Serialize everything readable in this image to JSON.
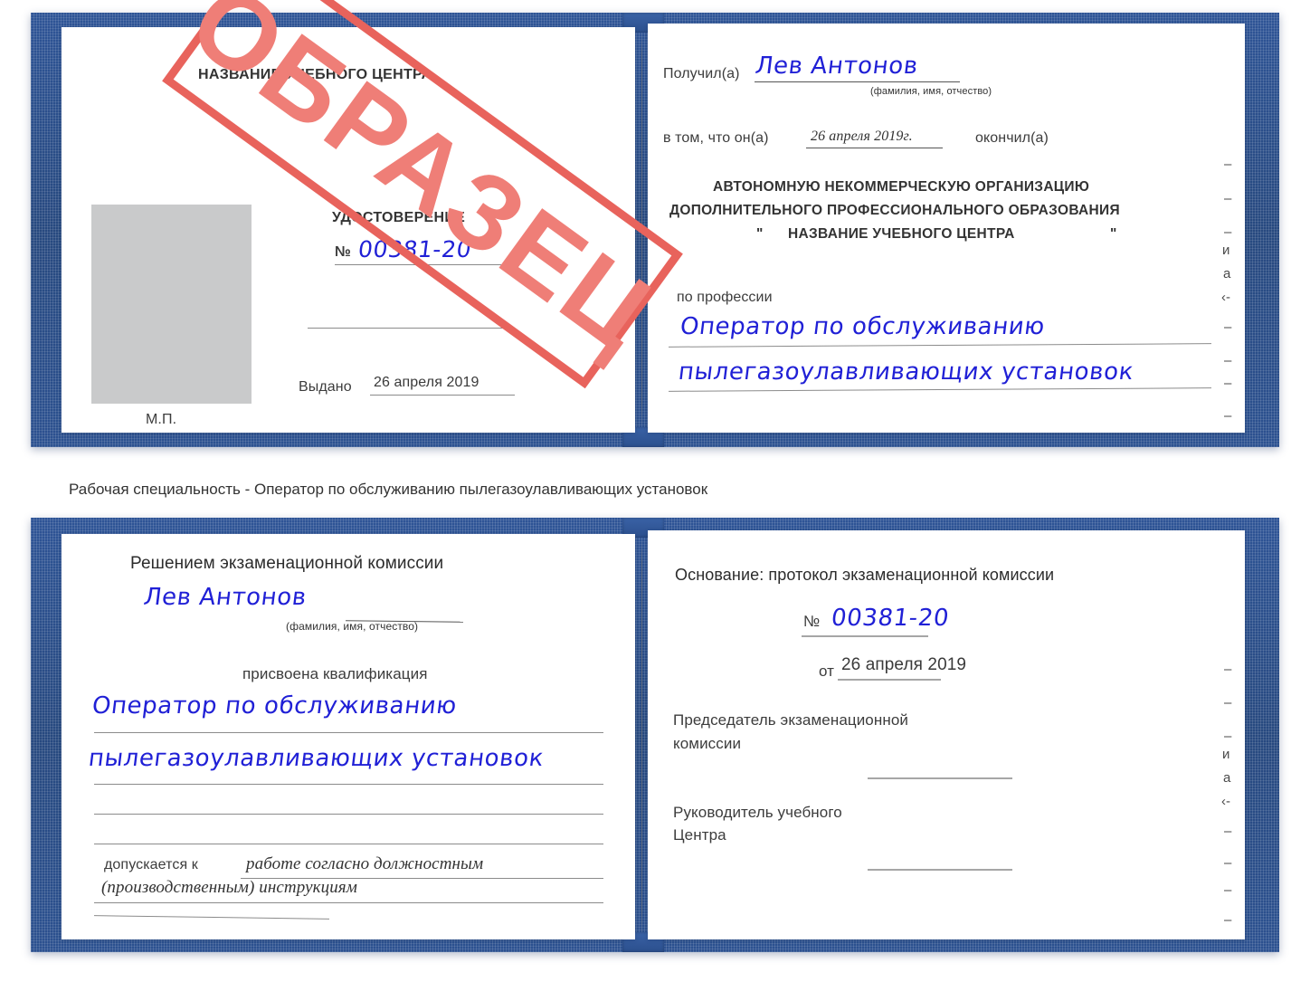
{
  "caption": "Рабочая специальность - Оператор по обслуживанию пылегазоулавливающих установок",
  "watermark": {
    "text": "ОБРАЗЕЦ",
    "border_color": "#e8635c",
    "text_color": "#ef7e77"
  },
  "colors": {
    "cover_blue": "#2c5190",
    "page_white": "#ffffff",
    "ink_blue": "#2020d6",
    "print_gray": "#3c3c3c",
    "photo_gray": "#c9cacb"
  },
  "certificate_top": {
    "left_page": {
      "center_name": "НАЗВАНИЕ УЧЕБНОГО ЦЕНТРА",
      "doc_type": "УДОСТОВЕРЕНИЕ",
      "number_label": "№",
      "number_value": "00381-20",
      "issued_label": "Выдано",
      "issued_value": "26 апреля 2019",
      "seal_label": "М.П.",
      "photo_placeholder": "photo-placeholder"
    },
    "right_page": {
      "received_label": "Получил(а)",
      "received_value": "Лев Антонов",
      "name_hint": "(фамилия, имя, отчество)",
      "that_he_label": "в том, что он(а)",
      "that_he_value": "26 апреля 2019г.",
      "finished_label": "окончил(а)",
      "org_line1": "АВТОНОМНУЮ НЕКОММЕРЧЕСКУЮ ОРГАНИЗАЦИЮ",
      "org_line2": "ДОПОЛНИТЕЛЬНОГО ПРОФЕССИОНАЛЬНОГО ОБРАЗОВАНИЯ",
      "org_quote_open": "\"",
      "org_line3": "НАЗВАНИЕ УЧЕБНОГО ЦЕНТРА",
      "org_quote_close": "\"",
      "profession_label": "по профессии",
      "profession_value_line1": "Оператор по обслуживанию",
      "profession_value_line2": "пылегазоулавливающих установок",
      "edge_fragments": [
        "–",
        "–",
        "–",
        "и",
        "а",
        "‹-",
        "–",
        "–",
        "–",
        "–"
      ]
    }
  },
  "certificate_bottom": {
    "left_page": {
      "title": "Решением экзаменационной комиссии",
      "name_value": "Лев Антонов",
      "name_hint": "(фамилия, имя, отчество)",
      "qualification_label": "присвоена квалификация",
      "qualification_line1": "Оператор по обслуживанию",
      "qualification_line2": "пылегазоулавливающих установок",
      "admitted_label": "допускается к",
      "admitted_value_line1": "работе согласно должностным",
      "admitted_value_line2": "(производственным) инструкциям"
    },
    "right_page": {
      "basis_label": "Основание: протокол экзаменационной комиссии",
      "number_label": "№",
      "number_value": "00381-20",
      "date_label": "от",
      "date_value": "26 апреля 2019",
      "chairman_line1": "Председатель экзаменационной",
      "chairman_line2": "комиссии",
      "head_line1": "Руководитель учебного",
      "head_line2": "Центра",
      "edge_fragments": [
        "–",
        "–",
        "–",
        "и",
        "а",
        "‹-",
        "–",
        "–",
        "–",
        "–"
      ]
    }
  }
}
